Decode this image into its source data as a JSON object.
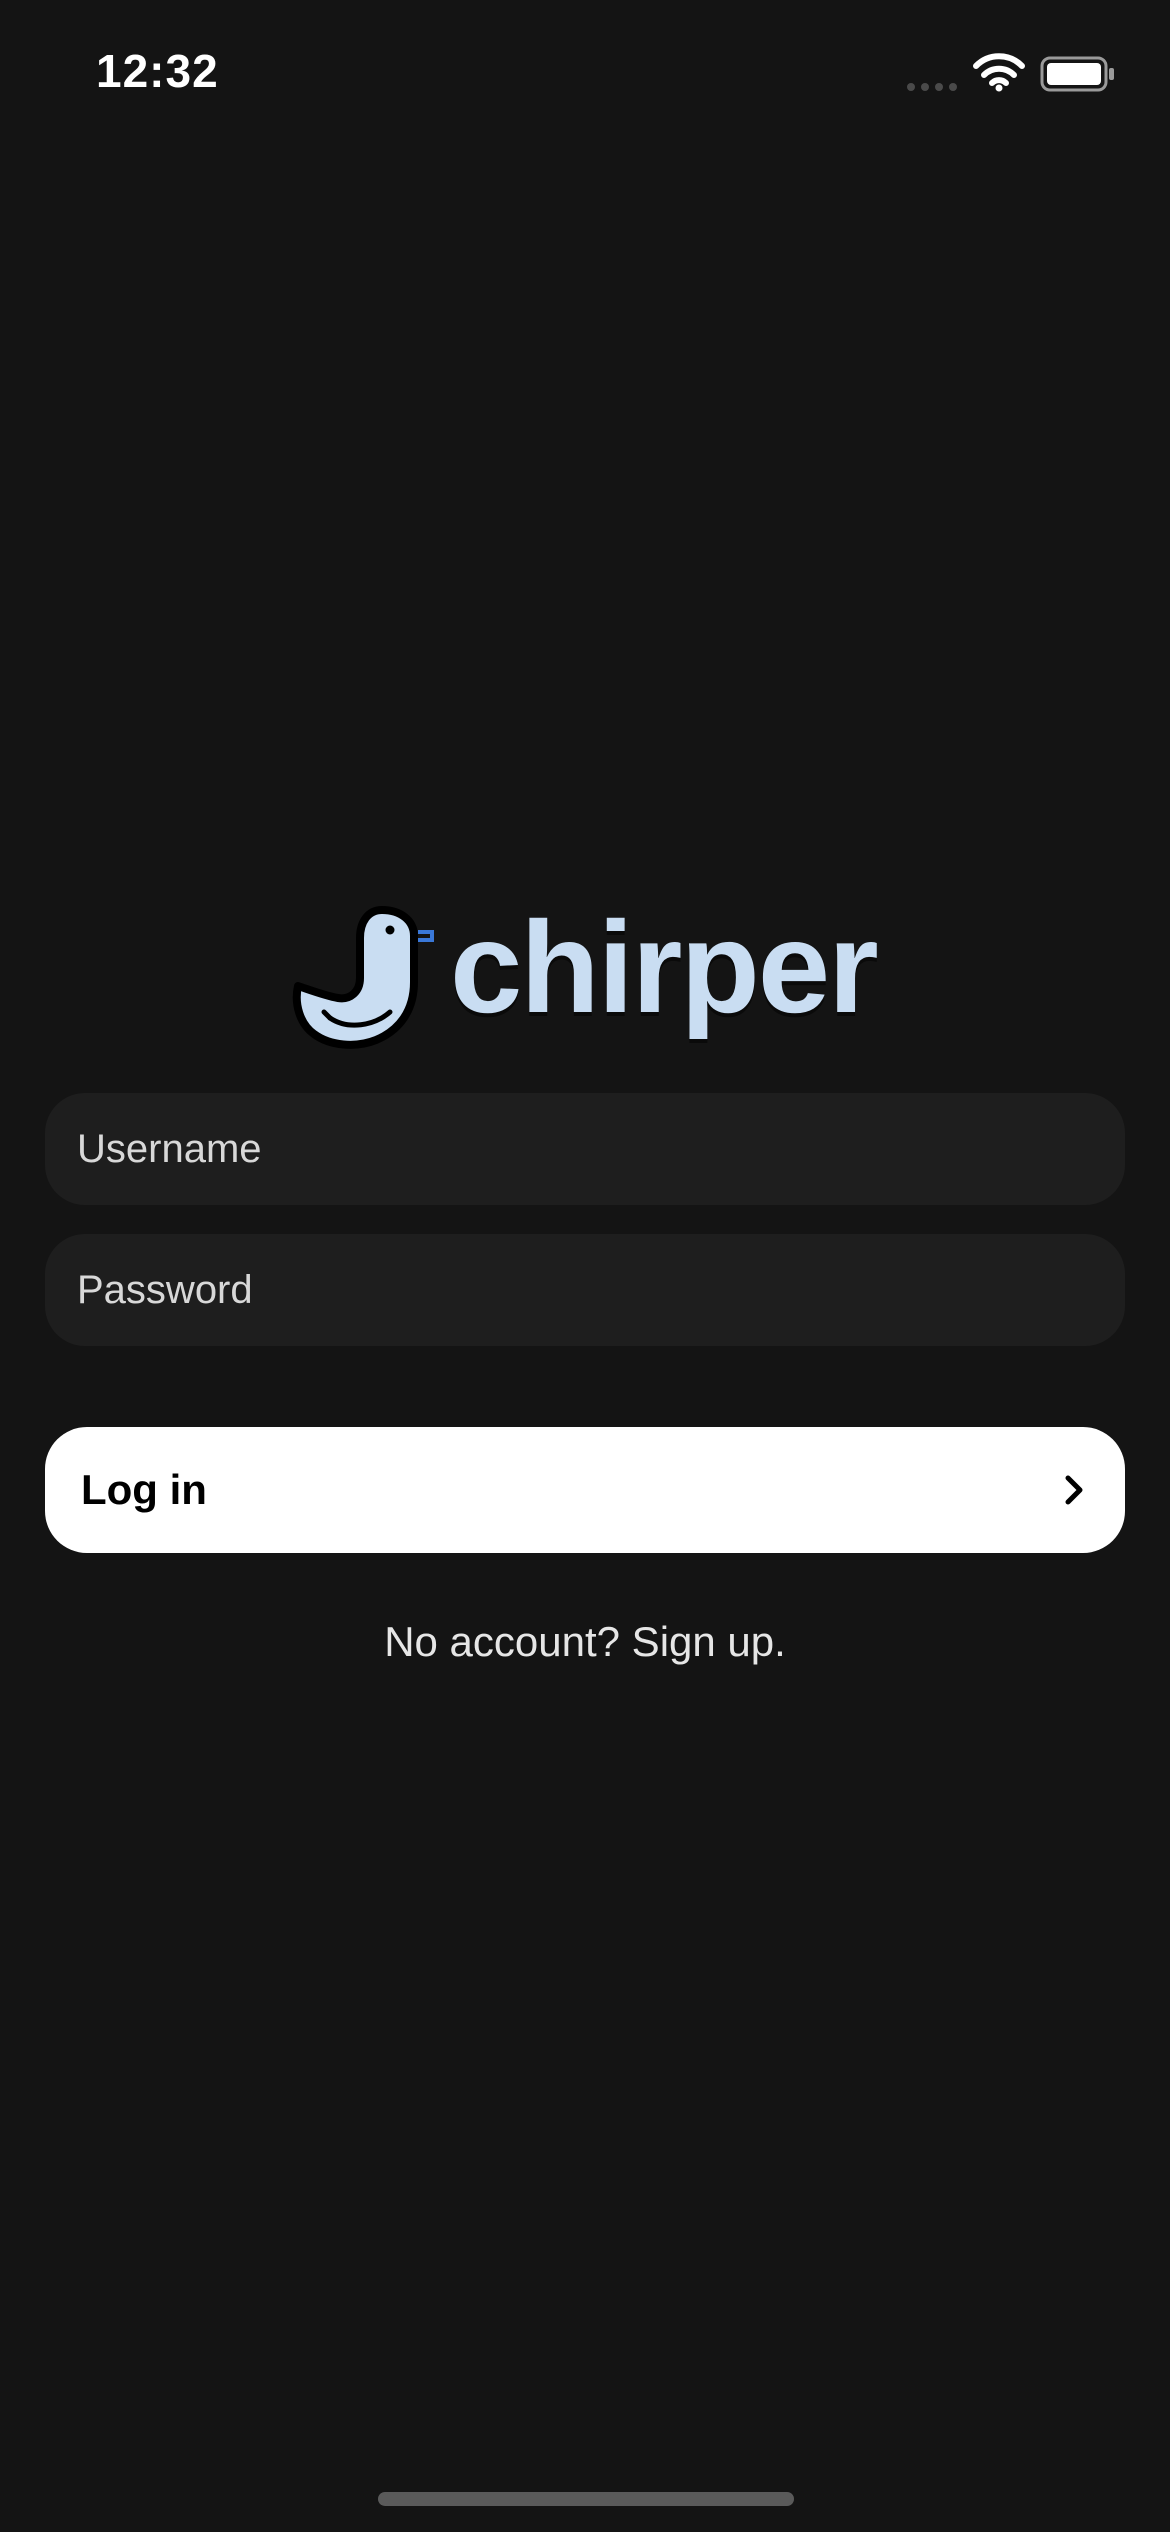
{
  "status_bar": {
    "time": "12:32",
    "icons": [
      "signal-icon",
      "wifi-icon",
      "battery-icon"
    ]
  },
  "brand": {
    "name": "chirper",
    "logo_icon": "bird-logo-icon",
    "color": "#c9ddf2"
  },
  "form": {
    "username_placeholder": "Username",
    "username_value": "",
    "password_placeholder": "Password",
    "password_value": "",
    "login_label": "Log in",
    "login_icon": "chevron-right-icon",
    "signup_text": "No account? Sign up."
  },
  "colors": {
    "background": "#141414",
    "field": "#1e1e1e",
    "button": "#ffffff"
  }
}
